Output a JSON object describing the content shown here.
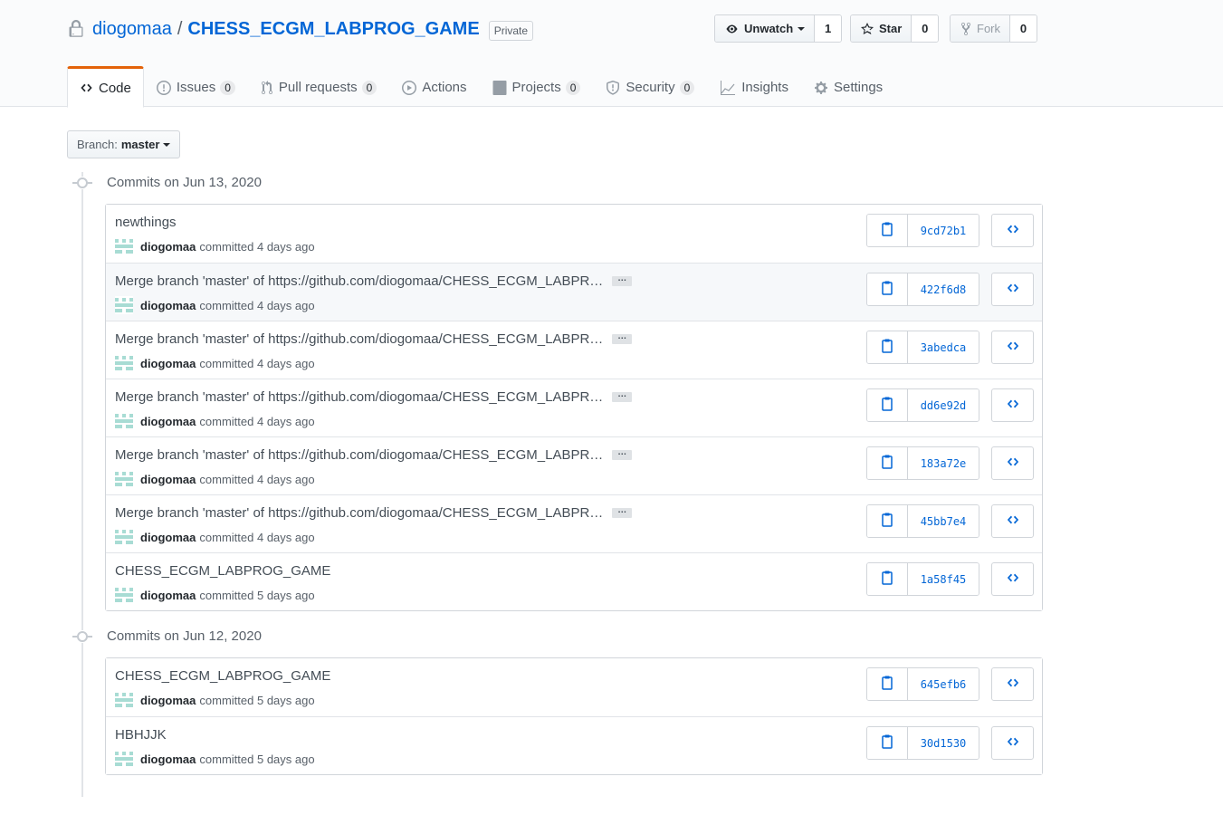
{
  "repo": {
    "owner": "diogomaa",
    "separator": "/",
    "name": "CHESS_ECGM_LABPROG_GAME",
    "visibility": "Private"
  },
  "actions": {
    "watch_label": "Unwatch",
    "watch_count": "1",
    "star_label": "Star",
    "star_count": "0",
    "fork_label": "Fork",
    "fork_count": "0"
  },
  "tabs": [
    {
      "label": "Code",
      "icon": "code-icon"
    },
    {
      "label": "Issues",
      "count": "0",
      "icon": "issue-icon"
    },
    {
      "label": "Pull requests",
      "count": "0",
      "icon": "pull-request-icon"
    },
    {
      "label": "Actions",
      "icon": "play-icon"
    },
    {
      "label": "Projects",
      "count": "0",
      "icon": "project-icon"
    },
    {
      "label": "Security",
      "count": "0",
      "icon": "shield-icon"
    },
    {
      "label": "Insights",
      "icon": "graph-icon"
    },
    {
      "label": "Settings",
      "icon": "gear-icon"
    }
  ],
  "branch": {
    "label": "Branch:",
    "value": "master"
  },
  "groups": [
    {
      "date": "Commits on Jun 13, 2020",
      "commits": [
        {
          "message": "newthings",
          "author": "diogomaa",
          "time": "committed 4 days ago",
          "sha": "9cd72b1",
          "truncated": false
        },
        {
          "message": "Merge branch 'master' of https://github.com/diogomaa/CHESS_ECGM_LABPR…",
          "author": "diogomaa",
          "time": "committed 4 days ago",
          "sha": "422f6d8",
          "truncated": true
        },
        {
          "message": "Merge branch 'master' of https://github.com/diogomaa/CHESS_ECGM_LABPR…",
          "author": "diogomaa",
          "time": "committed 4 days ago",
          "sha": "3abedca",
          "truncated": true
        },
        {
          "message": "Merge branch 'master' of https://github.com/diogomaa/CHESS_ECGM_LABPR…",
          "author": "diogomaa",
          "time": "committed 4 days ago",
          "sha": "dd6e92d",
          "truncated": true
        },
        {
          "message": "Merge branch 'master' of https://github.com/diogomaa/CHESS_ECGM_LABPR…",
          "author": "diogomaa",
          "time": "committed 4 days ago",
          "sha": "183a72e",
          "truncated": true
        },
        {
          "message": "Merge branch 'master' of https://github.com/diogomaa/CHESS_ECGM_LABPR…",
          "author": "diogomaa",
          "time": "committed 4 days ago",
          "sha": "45bb7e4",
          "truncated": true
        },
        {
          "message": "CHESS_ECGM_LABPROG_GAME",
          "author": "diogomaa",
          "time": "committed 5 days ago",
          "sha": "1a58f45",
          "truncated": false
        }
      ]
    },
    {
      "date": "Commits on Jun 12, 2020",
      "commits": [
        {
          "message": "CHESS_ECGM_LABPROG_GAME",
          "author": "diogomaa",
          "time": "committed 5 days ago",
          "sha": "645efb6",
          "truncated": false
        },
        {
          "message": "HBHJJK",
          "author": "diogomaa",
          "time": "committed 5 days ago",
          "sha": "30d1530",
          "truncated": false
        }
      ]
    }
  ],
  "colors": {
    "link": "#0366d6",
    "active_tab_accent": "#e36209",
    "avatar": "#a8dcd4"
  }
}
